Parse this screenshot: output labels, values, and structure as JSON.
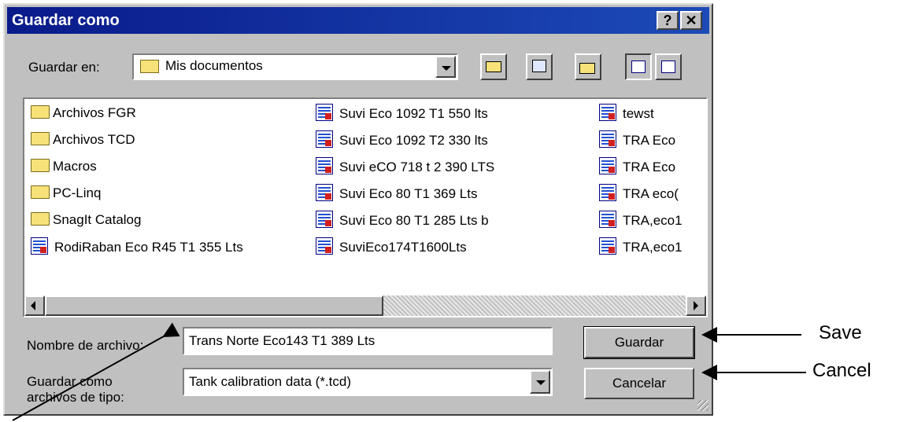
{
  "window": {
    "title": "Guardar como"
  },
  "titlebar_buttons": {
    "help": "?",
    "close": "✕"
  },
  "location": {
    "label": "Guardar en:",
    "value": "Mis documentos"
  },
  "toolbar": [
    "up-folder-icon",
    "desktop-icon",
    "new-folder-icon",
    "list-view-icon",
    "details-view-icon"
  ],
  "files": {
    "col1": [
      {
        "name": "Archivos FGR",
        "type": "folder"
      },
      {
        "name": "Archivos TCD",
        "type": "folder"
      },
      {
        "name": "Macros",
        "type": "folder"
      },
      {
        "name": "PC-Linq",
        "type": "folder"
      },
      {
        "name": "SnagIt Catalog",
        "type": "folder"
      },
      {
        "name": "RodiRaban Eco R45 T1 355 Lts",
        "type": "file"
      }
    ],
    "col2": [
      {
        "name": "Suvi Eco 1092 T1 550 lts",
        "type": "file"
      },
      {
        "name": "Suvi Eco 1092 T2 330 lts",
        "type": "file"
      },
      {
        "name": "Suvi eCO 718 t 2 390 LTS",
        "type": "file"
      },
      {
        "name": "Suvi Eco 80 T1  369 Lts",
        "type": "file"
      },
      {
        "name": "Suvi Eco 80 T1 285 Lts b",
        "type": "file"
      },
      {
        "name": "SuviEco174T1600Lts",
        "type": "file"
      }
    ],
    "col3": [
      {
        "name": "tewst",
        "type": "file"
      },
      {
        "name": "TRA Eco",
        "type": "file"
      },
      {
        "name": "TRA Eco",
        "type": "file"
      },
      {
        "name": "TRA eco(",
        "type": "file"
      },
      {
        "name": "TRA,eco1",
        "type": "file"
      },
      {
        "name": "TRA,eco1",
        "type": "file"
      }
    ]
  },
  "filename": {
    "label": "Nombre de archivo:",
    "value": "Trans Norte Eco143 T1 389 Lts"
  },
  "filetype": {
    "label_line1": "Guardar como",
    "label_line2": "archivos de tipo:",
    "value": "Tank calibration data (*.tcd)"
  },
  "buttons": {
    "save": "Guardar",
    "cancel": "Cancelar"
  },
  "annotations": {
    "save": "Save",
    "cancel": "Cancel"
  }
}
